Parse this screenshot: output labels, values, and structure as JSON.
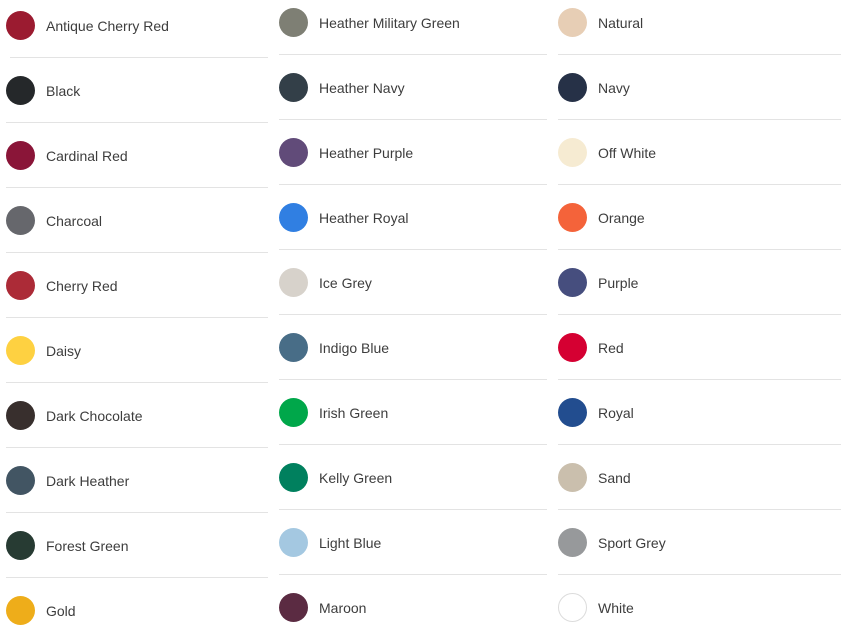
{
  "columns": [
    {
      "items": [
        {
          "name": "Antique Cherry Red",
          "color": "#9b1b30"
        },
        {
          "name": "Black",
          "color": "#25282a"
        },
        {
          "name": "Cardinal Red",
          "color": "#8a1538"
        },
        {
          "name": "Charcoal",
          "color": "#66676c"
        },
        {
          "name": "Cherry Red",
          "color": "#ac2b37"
        },
        {
          "name": "Daisy",
          "color": "#fed141"
        },
        {
          "name": "Dark Chocolate",
          "color": "#382f2d"
        },
        {
          "name": "Dark Heather",
          "color": "#425563"
        },
        {
          "name": "Forest Green",
          "color": "#273b33"
        },
        {
          "name": "Gold",
          "color": "#eead1a"
        }
      ]
    },
    {
      "items": [
        {
          "name": "Heather Military Green",
          "color": "#7e7f74"
        },
        {
          "name": "Heather Navy",
          "color": "#333f48"
        },
        {
          "name": "Heather Purple",
          "color": "#614b79"
        },
        {
          "name": "Heather Royal",
          "color": "#307fe2"
        },
        {
          "name": "Ice Grey",
          "color": "#d7d2cb"
        },
        {
          "name": "Indigo Blue",
          "color": "#486d87"
        },
        {
          "name": "Irish Green",
          "color": "#00a74a"
        },
        {
          "name": "Kelly Green",
          "color": "#00805e"
        },
        {
          "name": "Light Blue",
          "color": "#a4c8e1"
        },
        {
          "name": "Maroon",
          "color": "#5b2b42"
        }
      ]
    },
    {
      "items": [
        {
          "name": "Natural",
          "color": "#e7ceb5"
        },
        {
          "name": "Navy",
          "color": "#263147"
        },
        {
          "name": "Off White",
          "color": "#f6ebd2"
        },
        {
          "name": "Orange",
          "color": "#f4633a"
        },
        {
          "name": "Purple",
          "color": "#464e7e"
        },
        {
          "name": "Red",
          "color": "#d50032"
        },
        {
          "name": "Royal",
          "color": "#224d8f"
        },
        {
          "name": "Sand",
          "color": "#cabfad"
        },
        {
          "name": "Sport Grey",
          "color": "#97999b"
        },
        {
          "name": "White",
          "color": "#ffffff"
        }
      ]
    }
  ]
}
